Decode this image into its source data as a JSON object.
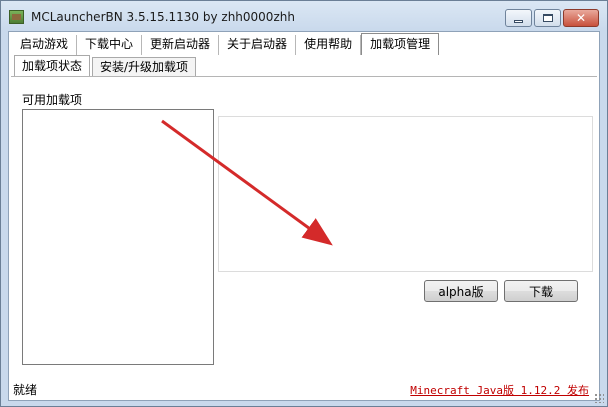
{
  "window": {
    "title": "MCLauncherBN 3.5.15.1130  by zhh0000zhh",
    "controls": {
      "minimize": "minimize",
      "maximize": "maximize",
      "close": "✕"
    }
  },
  "tabs": [
    {
      "label": "启动游戏",
      "active": false
    },
    {
      "label": "下载中心",
      "active": false
    },
    {
      "label": "更新启动器",
      "active": false
    },
    {
      "label": "关于启动器",
      "active": false
    },
    {
      "label": "使用帮助",
      "active": false
    },
    {
      "label": "加载项管理",
      "active": true
    }
  ],
  "sub_tabs": [
    {
      "label": "加载项状态",
      "active": true
    },
    {
      "label": "安装/升级加载项",
      "active": false
    }
  ],
  "addons": {
    "label": "可用加载项",
    "items": []
  },
  "buttons": {
    "alpha": "alpha版",
    "download": "下载"
  },
  "status": {
    "text": "就绪",
    "link": "Minecraft Java版 1.12.2 发布"
  },
  "colors": {
    "link": "#c00000",
    "arrow": "#d42a2a"
  }
}
